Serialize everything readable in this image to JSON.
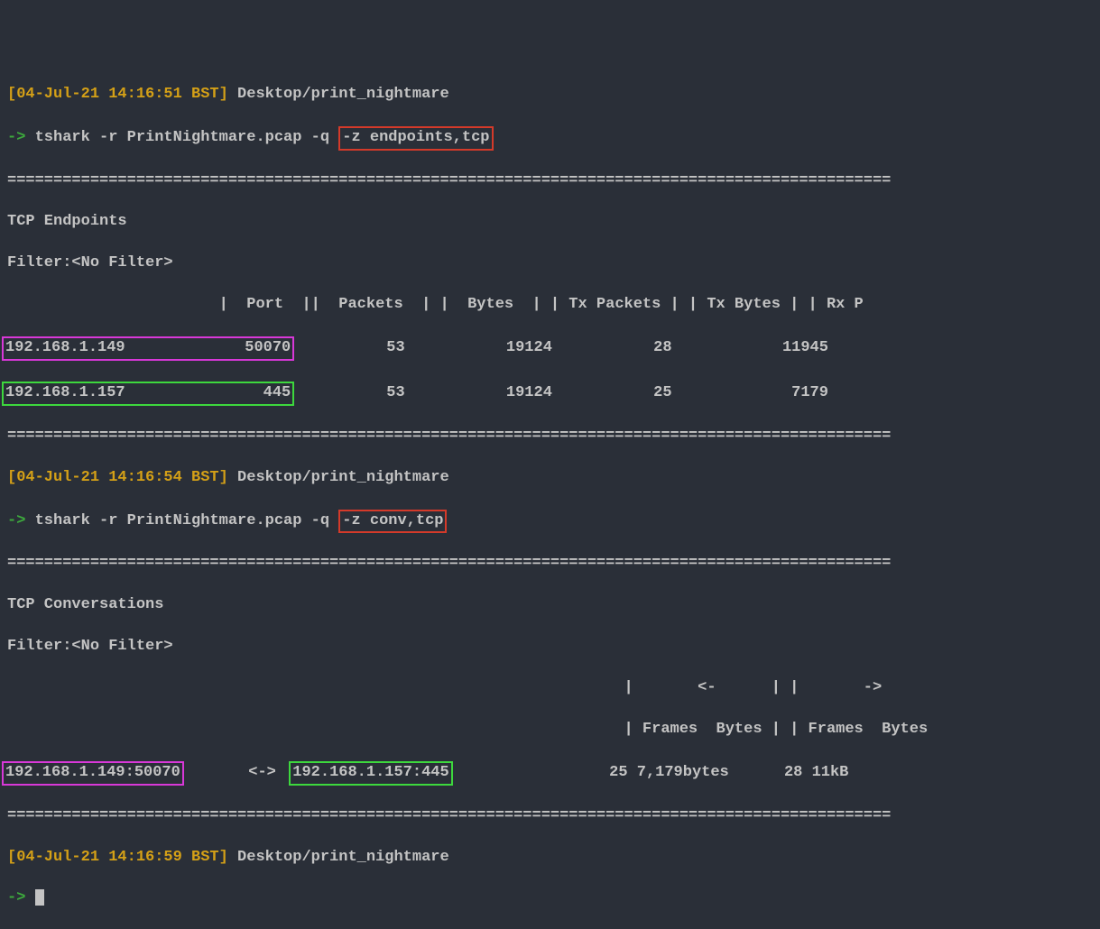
{
  "prompt1": {
    "timestamp": "[04-Jul-21 14:16:51 BST]",
    "path": "Desktop/print_nightmare",
    "arrow": "->",
    "cmd_prefix": "tshark -r PrintNightmare.pcap -q ",
    "cmd_highlight": "-z endpoints,tcp"
  },
  "sep": "================================================================================================",
  "endpoints": {
    "title": "TCP Endpoints",
    "filter": "Filter:<No Filter>",
    "header_port": "                       |  Port  ||",
    "header_rest": "  Packets  | |  Bytes  | | Tx Packets | | Tx Bytes | | Rx P",
    "row1_box": "192.168.1.149             50070",
    "row1_rest": "          53           19124           28            11945",
    "row2_box": "192.168.1.157               445",
    "row2_rest": "          53           19124           25             7179"
  },
  "prompt2": {
    "timestamp": "[04-Jul-21 14:16:54 BST]",
    "path": "Desktop/print_nightmare",
    "arrow": "->",
    "cmd_prefix": "tshark -r PrintNightmare.pcap -q ",
    "cmd_highlight": "-z conv,tcp"
  },
  "conv": {
    "title": "TCP Conversations",
    "filter": "Filter:<No Filter>",
    "dirline": "                                                                   |       <-      | |       ->   ",
    "header": "                                                                   | Frames  Bytes | | Frames  Bytes",
    "row_left": "192.168.1.149:50070",
    "row_mid": "       <->  ",
    "row_right": "192.168.1.157:445",
    "row_rest": "                 25 7,179bytes      28 11kB"
  },
  "prompt3": {
    "timestamp": "[04-Jul-21 14:16:59 BST]",
    "path": "Desktop/print_nightmare",
    "arrow": "->"
  }
}
